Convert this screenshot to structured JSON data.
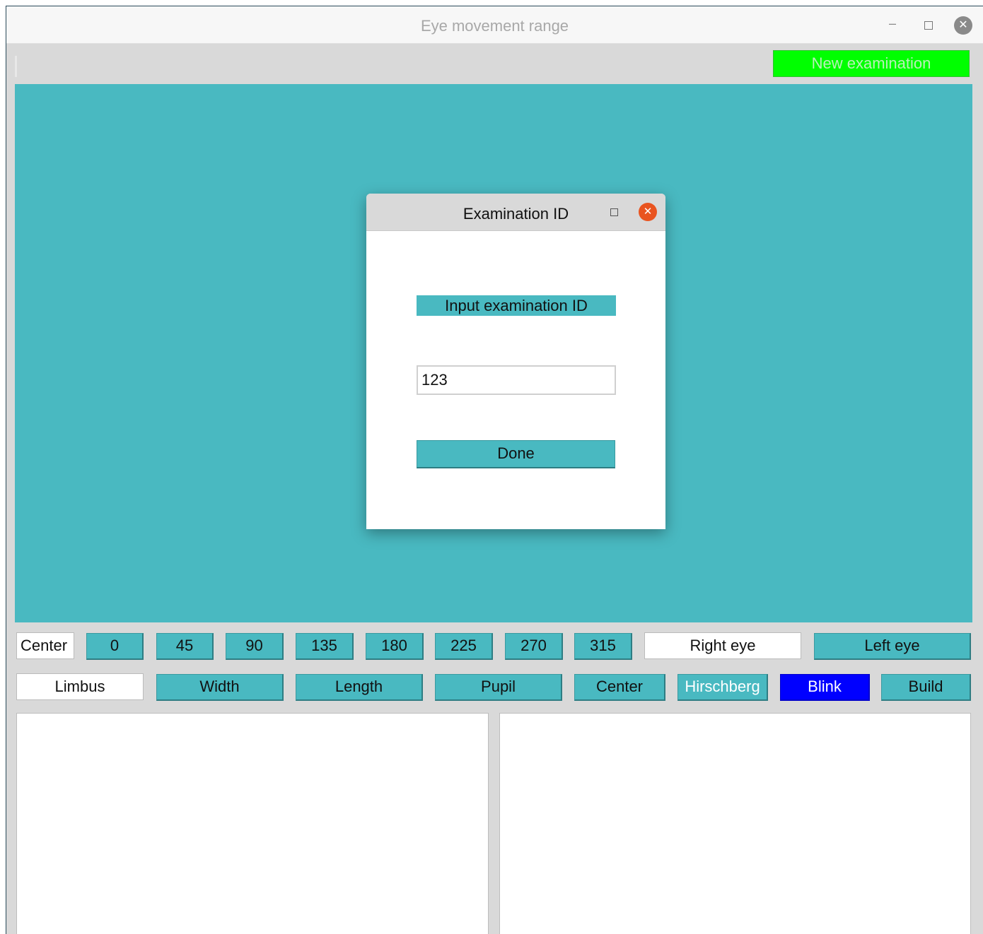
{
  "window": {
    "title": "Eye movement range",
    "minimize_glyph": "–",
    "close_glyph": "✕"
  },
  "toolbar": {
    "new_examination_label": "New examination"
  },
  "dialog": {
    "title": "Examination ID",
    "close_glyph": "✕",
    "prompt": "Input examination ID",
    "input_value": "123",
    "done_label": "Done"
  },
  "row1": {
    "center_label": "Center",
    "angles": [
      "0",
      "45",
      "90",
      "135",
      "180",
      "225",
      "270",
      "315"
    ],
    "right_eye": "Right eye",
    "left_eye": "Left eye"
  },
  "row2": {
    "limbus": "Limbus",
    "width": "Width",
    "length": "Length",
    "pupil": "Pupil",
    "center": "Center",
    "hirschberg": "Hirschberg",
    "blink": "Blink",
    "build": "Build"
  },
  "colors": {
    "accent_teal": "#49b9c1",
    "new_exam_green": "#00ff00",
    "blink_blue": "#0000ff",
    "dialog_close": "#e95420"
  }
}
